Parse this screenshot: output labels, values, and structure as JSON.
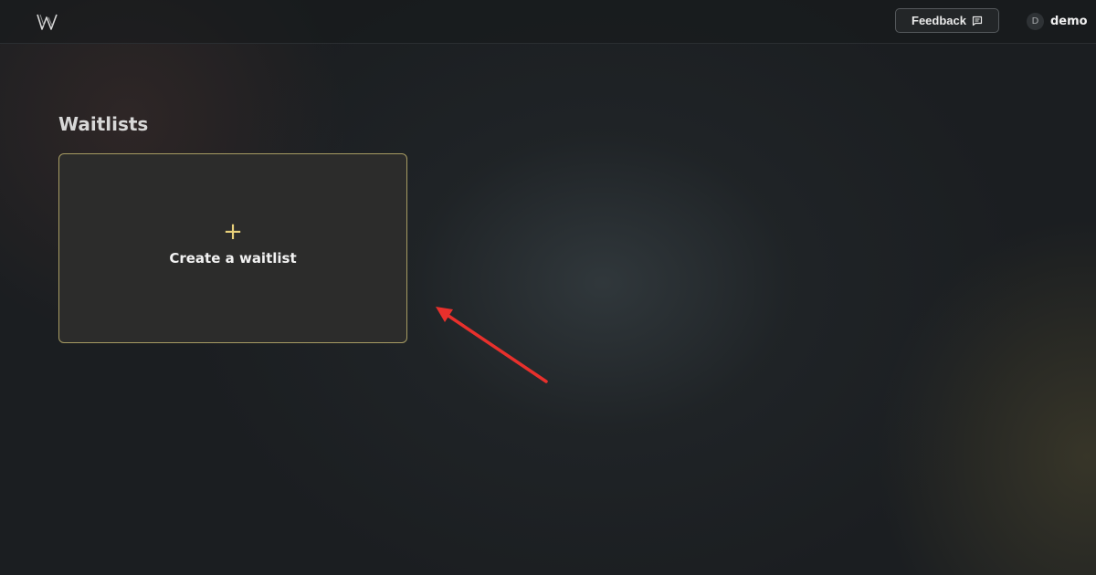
{
  "header": {
    "logo_icon": "w-logo-icon",
    "feedback_label": "Feedback",
    "feedback_icon": "message-square-icon",
    "user": {
      "initial": "D",
      "name": "demo"
    }
  },
  "main": {
    "title": "Waitlists",
    "create_card": {
      "icon": "plus-icon",
      "plus": "+",
      "label": "Create a waitlist"
    }
  },
  "colors": {
    "accent": "#e8d07a",
    "card_border": "#a79c63",
    "annotation_arrow": "#e8302c"
  }
}
